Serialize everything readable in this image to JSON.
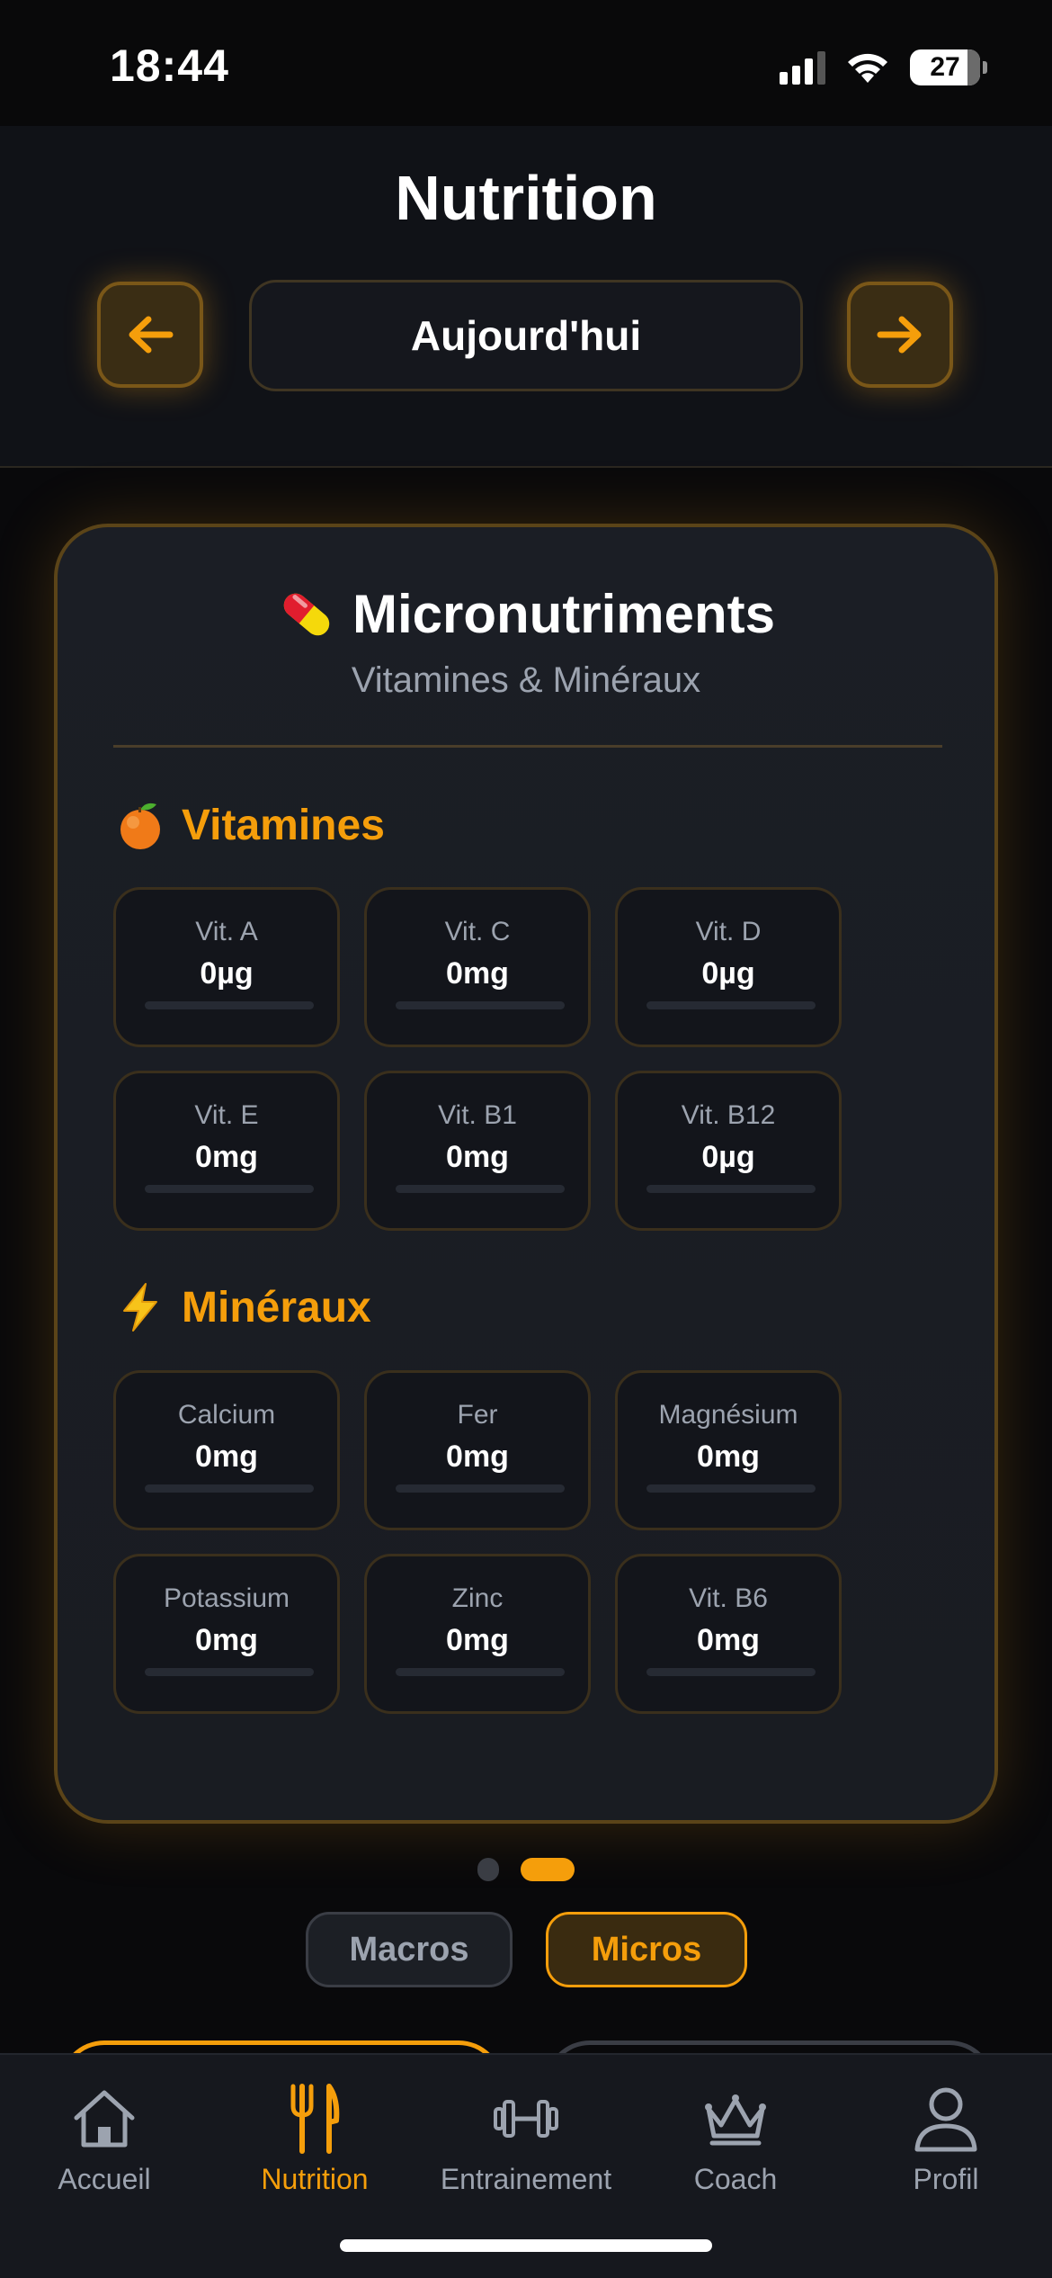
{
  "status_bar": {
    "time": "18:44",
    "battery": "27"
  },
  "header": {
    "title": "Nutrition",
    "date_label": "Aujourd'hui",
    "prev_icon": "arrow-left-icon",
    "next_icon": "arrow-right-icon"
  },
  "card": {
    "title": "Micronutriments",
    "title_icon": "pill-icon",
    "subtitle": "Vitamines & Minéraux",
    "vitamins": {
      "title": "Vitamines",
      "icon": "orange-fruit-icon",
      "items": [
        {
          "label": "Vit. A",
          "value": "0µg",
          "progress": 0
        },
        {
          "label": "Vit. C",
          "value": "0mg",
          "progress": 0
        },
        {
          "label": "Vit. D",
          "value": "0µg",
          "progress": 0
        },
        {
          "label": "Vit. E",
          "value": "0mg",
          "progress": 0
        },
        {
          "label": "Vit. B1",
          "value": "0mg",
          "progress": 0
        },
        {
          "label": "Vit. B12",
          "value": "0µg",
          "progress": 0
        }
      ]
    },
    "minerals": {
      "title": "Minéraux",
      "icon": "lightning-icon",
      "items": [
        {
          "label": "Calcium",
          "value": "0mg",
          "progress": 0
        },
        {
          "label": "Fer",
          "value": "0mg",
          "progress": 0
        },
        {
          "label": "Magnésium",
          "value": "0mg",
          "progress": 0
        },
        {
          "label": "Potassium",
          "value": "0mg",
          "progress": 0
        },
        {
          "label": "Zinc",
          "value": "0mg",
          "progress": 0
        },
        {
          "label": "Vit. B6",
          "value": "0mg",
          "progress": 0
        }
      ]
    }
  },
  "pager": {
    "active_page": 2,
    "page_count": 2
  },
  "segments": {
    "macros": "Macros",
    "micros": "Micros",
    "active": "micros"
  },
  "tabbar": {
    "items": [
      {
        "label": "Accueil",
        "icon": "home-icon"
      },
      {
        "label": "Nutrition",
        "icon": "fork-knife-icon"
      },
      {
        "label": "Entrainement",
        "icon": "dumbbell-icon"
      },
      {
        "label": "Coach",
        "icon": "crown-icon"
      },
      {
        "label": "Profil",
        "icon": "person-icon"
      }
    ],
    "active": "Nutrition"
  },
  "colors": {
    "accent": "#f59e0b",
    "background": "#09090b",
    "card": "#1b1e25",
    "muted": "#9ca3af"
  }
}
